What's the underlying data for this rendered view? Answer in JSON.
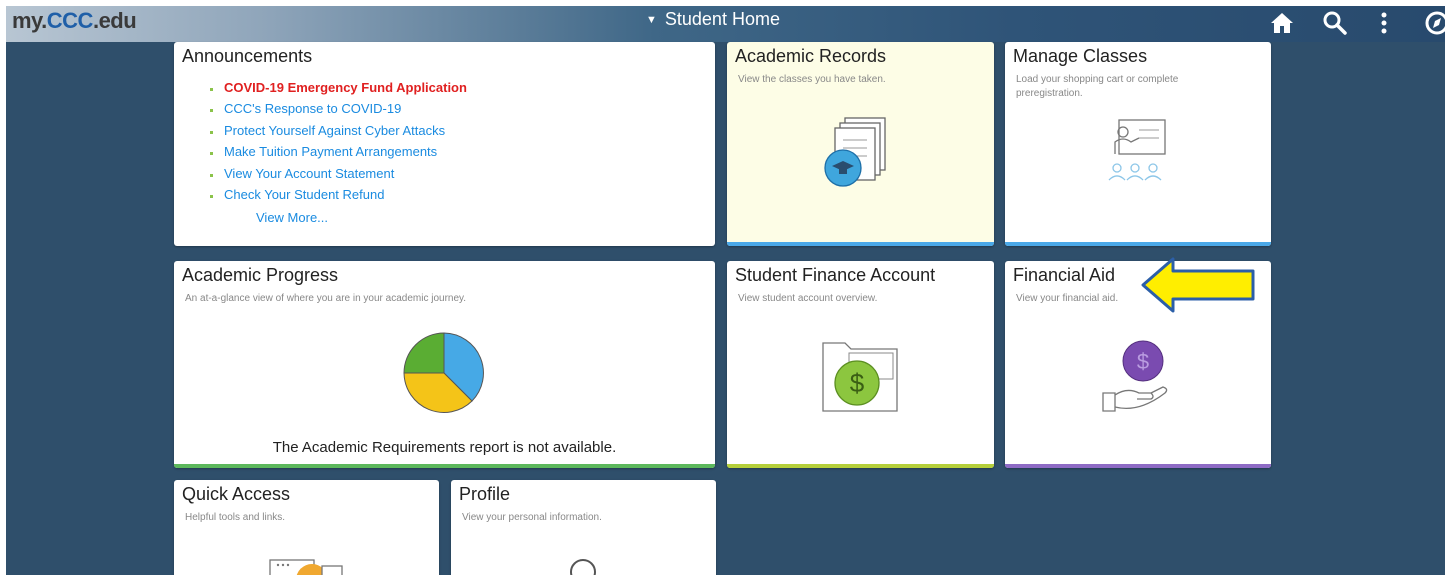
{
  "header": {
    "logo_part1": "my.",
    "logo_part2": "CCC",
    "logo_part3": ".edu",
    "title": "Student Home",
    "icons": [
      "home-icon",
      "search-icon",
      "more-vertical-icon",
      "navbar-compass-icon"
    ]
  },
  "tiles": {
    "announcements": {
      "title": "Announcements",
      "items": [
        "COVID-19 Emergency Fund Application",
        "CCC's Response to COVID-19",
        "Protect Yourself Against Cyber Attacks",
        "Make Tuition Payment Arrangements",
        "View Your Account Statement",
        "Check Your Student Refund"
      ],
      "view_more": "View More..."
    },
    "academic_records": {
      "title": "Academic Records",
      "subtitle": "View the classes you have taken."
    },
    "manage_classes": {
      "title": "Manage Classes",
      "subtitle": "Load your shopping cart or complete preregistration."
    },
    "academic_progress": {
      "title": "Academic Progress",
      "subtitle": "An at-a-glance view of where you are in your academic journey.",
      "message": "The Academic Requirements report is not available."
    },
    "student_finance": {
      "title": "Student Finance Account",
      "subtitle": "View student account overview."
    },
    "financial_aid": {
      "title": "Financial Aid",
      "subtitle": "View your financial aid."
    },
    "quick_access": {
      "title": "Quick Access",
      "subtitle": "Helpful tools and links."
    },
    "profile": {
      "title": "Profile",
      "subtitle": "View your personal information."
    }
  },
  "colors": {
    "accent_blue": "#1a8be0",
    "alert_red": "#e02020",
    "highlight_arrow": "#ffee00",
    "tile_bar_blue": "#4aa8e8",
    "tile_bar_green": "#5cb85c",
    "tile_bar_lime": "#b5cf3a",
    "tile_bar_purple": "#8e6bc5"
  }
}
